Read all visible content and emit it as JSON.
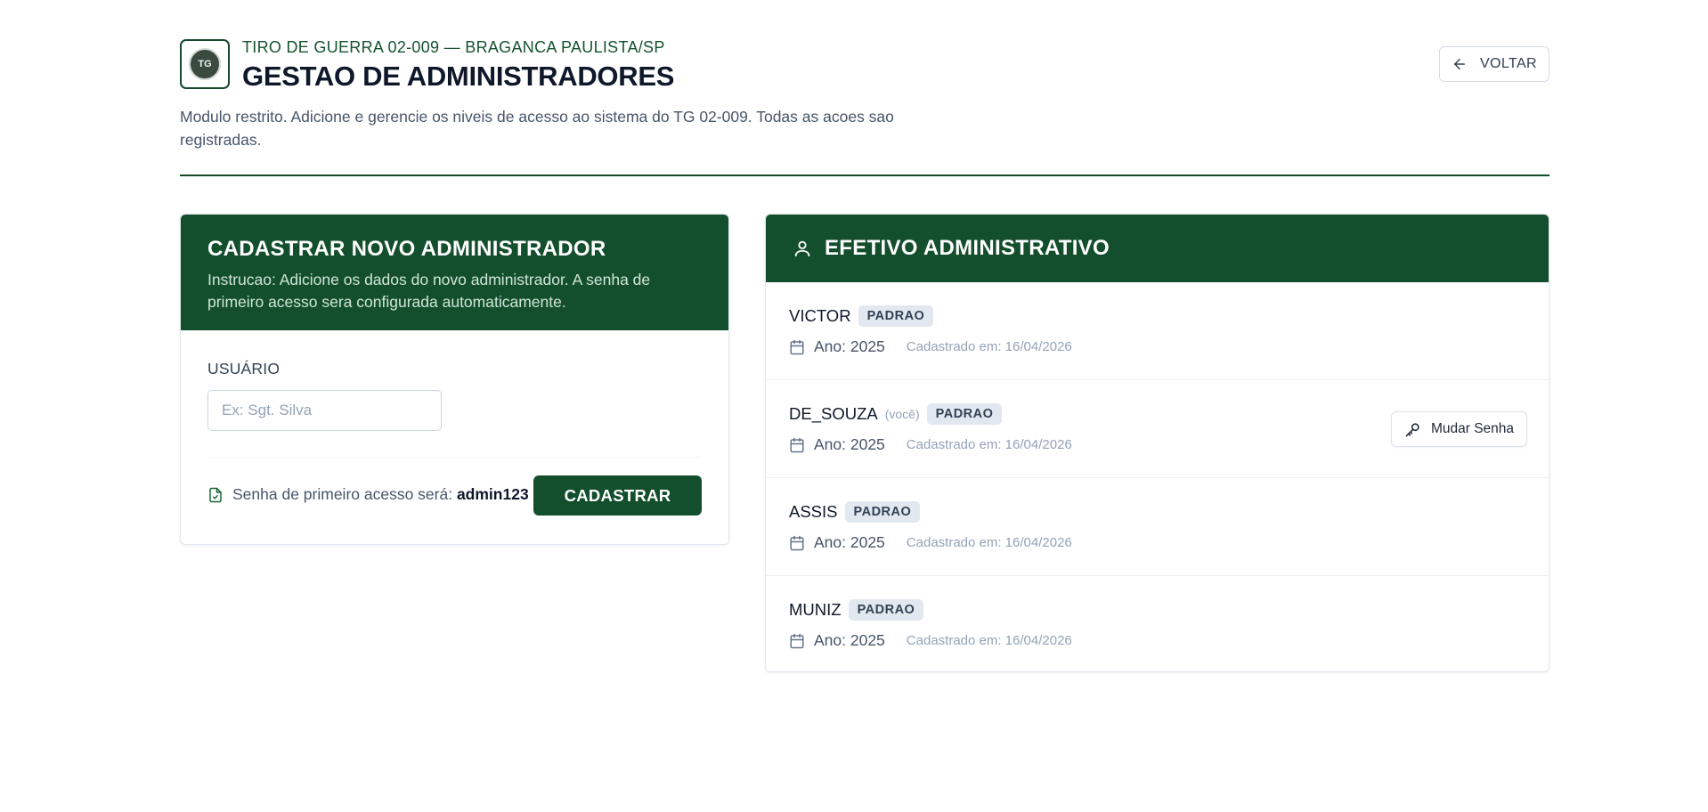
{
  "header": {
    "logo_text": "TG",
    "subtitle": "TIRO DE GUERRA 02-009 — BRAGANCA PAULISTA/SP",
    "title": "GESTAO DE ADMINISTRADORES",
    "description": "Modulo restrito. Adicione e gerencie os niveis de acesso ao sistema do TG 02-009. Todas as acoes sao registradas.",
    "back_label": "VOLTAR"
  },
  "form": {
    "title": "CADASTRAR NOVO ADMINISTRADOR",
    "instruction": "Instrucao: Adicione os dados do novo administrador. A senha de primeiro acesso sera configurada automaticamente.",
    "user_label": "USUÁRIO",
    "user_placeholder": "Ex: Sgt. Silva",
    "user_value": "",
    "password_note": "Senha de primeiro acesso será: ",
    "default_password": "admin123",
    "submit_label": "CADASTRAR"
  },
  "staff": {
    "title": "EFETIVO ADMINISTRATIVO",
    "admins": [
      {
        "name": "VICTOR",
        "you": "",
        "role": "PADRAO",
        "year": "Ano: 2025",
        "registered": "Cadastrado em: 16/04/2026"
      },
      {
        "name": "DE_SOUZA",
        "you": "(você)",
        "role": "PADRAO",
        "year": "Ano: 2025",
        "registered": "Cadastrado em: 16/04/2026",
        "action": "Mudar Senha"
      },
      {
        "name": "ASSIS",
        "you": "",
        "role": "PADRAO",
        "year": "Ano: 2025",
        "registered": "Cadastrado em: 16/04/2026"
      },
      {
        "name": "MUNIZ",
        "you": "",
        "role": "PADRAO",
        "year": "Ano: 2025",
        "registered": "Cadastrado em: 16/04/2026"
      }
    ]
  },
  "colors": {
    "brand_green": "#134f2c",
    "text_dark": "#0f172a",
    "muted": "#94a3b8",
    "badge_bg": "#e2e8f0"
  },
  "icons": {
    "back": "arrow-left-icon",
    "user": "user-icon",
    "calendar": "calendar-icon",
    "key": "key-icon",
    "doc": "file-check-icon"
  }
}
